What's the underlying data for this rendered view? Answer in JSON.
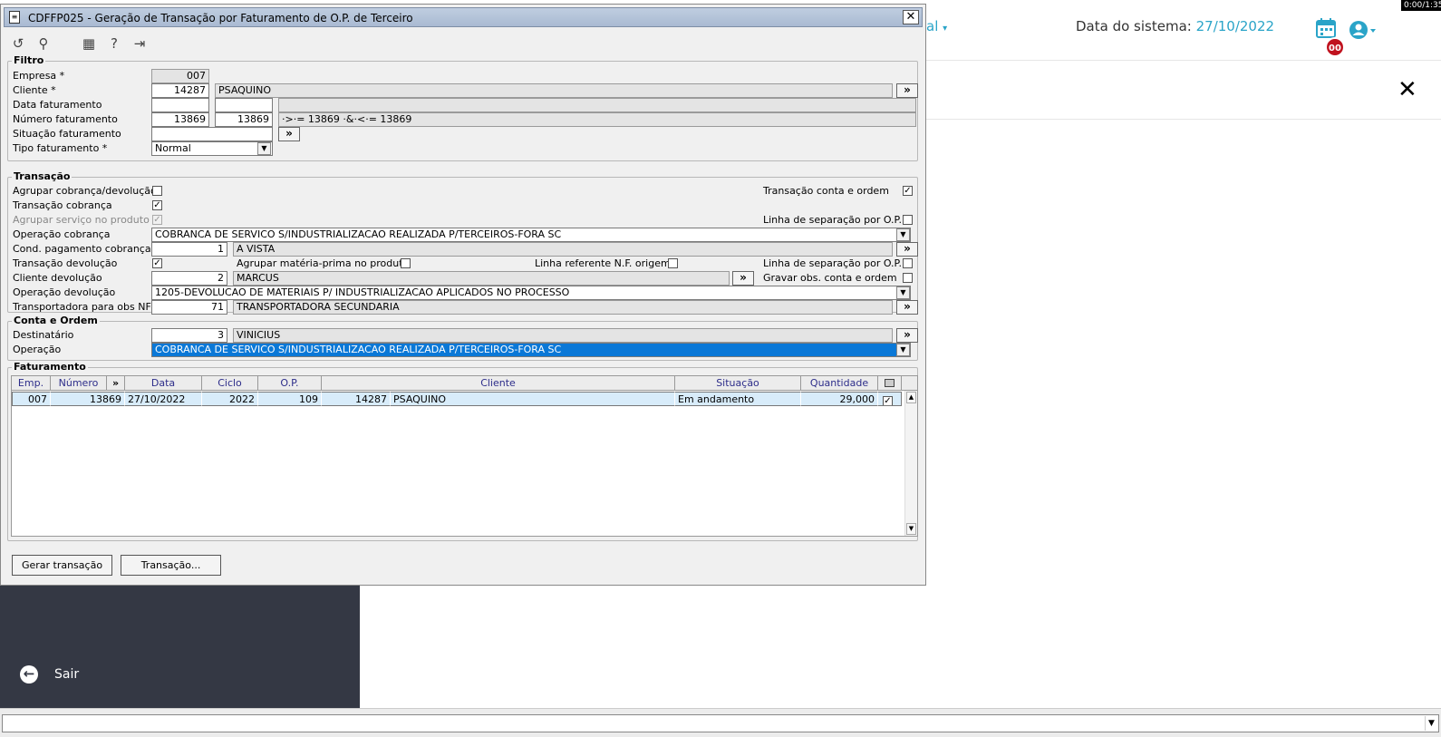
{
  "background": {
    "menu_fragment": "al",
    "date_label": "Data do sistema:",
    "date_value": "27/10/2022",
    "badge": "00",
    "timer": "0:00/1:35",
    "exit_label": "Sair"
  },
  "window": {
    "title": "CDFFP025 - Geração de Transação por Faturamento de O.P. de Terceiro",
    "close": "✕"
  },
  "filtro": {
    "group_label": "Filtro",
    "empresa_label": "Empresa *",
    "empresa": "007",
    "cliente_label": "Cliente *",
    "cliente_cod": "14287",
    "cliente_nome": "PSAQUINO",
    "data_label": "Data faturamento",
    "data_de": "",
    "data_ate": "",
    "numero_label": "Número faturamento",
    "numero_de": "13869",
    "numero_ate": "13869",
    "numero_expr": "·>·= 13869 ·&·<·= 13869",
    "situacao_label": "Situação faturamento",
    "situacao": "",
    "tipo_label": "Tipo faturamento *",
    "tipo": "Normal"
  },
  "transacao": {
    "group_label": "Transação",
    "agrupar_cob_label": "Agrupar cobrança/devolução",
    "trans_cob_label": "Transação cobrança",
    "agrupar_serv_label": "Agrupar serviço no produto",
    "trans_conta_label": "Transação conta e ordem",
    "linha_sep1_label": "Linha de separação por O.P.",
    "op_cob_label": "Operação cobrança",
    "op_cob": "COBRANCA DE SERVICO S/INDUSTRIALIZACAO REALIZADA P/TERCEIROS-FORA SC",
    "cond_label": "Cond. pagamento cobrança *",
    "cond_cod": "1",
    "cond_nome": "A VISTA",
    "trans_dev_label": "Transação devolução",
    "agrupar_mp_label": "Agrupar matéria-prima no produto",
    "linha_ref_label": "Linha referente N.F. origem",
    "linha_sep2_label": "Linha de separação por O.P.",
    "cli_dev_label": "Cliente devolução",
    "cli_dev_cod": "2",
    "cli_dev_nome": "MARCUS",
    "gravar_obs_label": "Gravar obs. conta e ordem",
    "op_dev_label": "Operação devolução",
    "op_dev": "1205-DEVOLUCAO DE MATERIAIS P/ INDUSTRIALIZACAO APLICADOS NO PROCESSO",
    "transp_label": "Transportadora para obs NF",
    "transp_cod": "71",
    "transp_nome": "TRANSPORTADORA SECUNDARIA"
  },
  "conta": {
    "group_label": "Conta e Ordem",
    "dest_label": "Destinatário",
    "dest_cod": "3",
    "dest_nome": "VINICIUS",
    "op_label": "Operação",
    "op": "COBRANCA DE SERVICO S/INDUSTRIALIZACAO REALIZADA P/TERCEIROS-FORA SC"
  },
  "faturamento": {
    "group_label": "Faturamento",
    "headers": [
      "Emp.",
      "Número",
      "»",
      "Data",
      "Ciclo",
      "O.P.",
      "Cliente",
      "Situação",
      "Quantidade"
    ],
    "row": {
      "emp": "007",
      "numero": "13869",
      "data": "27/10/2022",
      "ciclo": "2022",
      "op": "109",
      "cli_cod": "14287",
      "cli_nome": "PSAQUINO",
      "situacao": "Em andamento",
      "quantidade": "29,000"
    }
  },
  "buttons": {
    "gerar": "Gerar transação",
    "transacao": "Transação..."
  }
}
